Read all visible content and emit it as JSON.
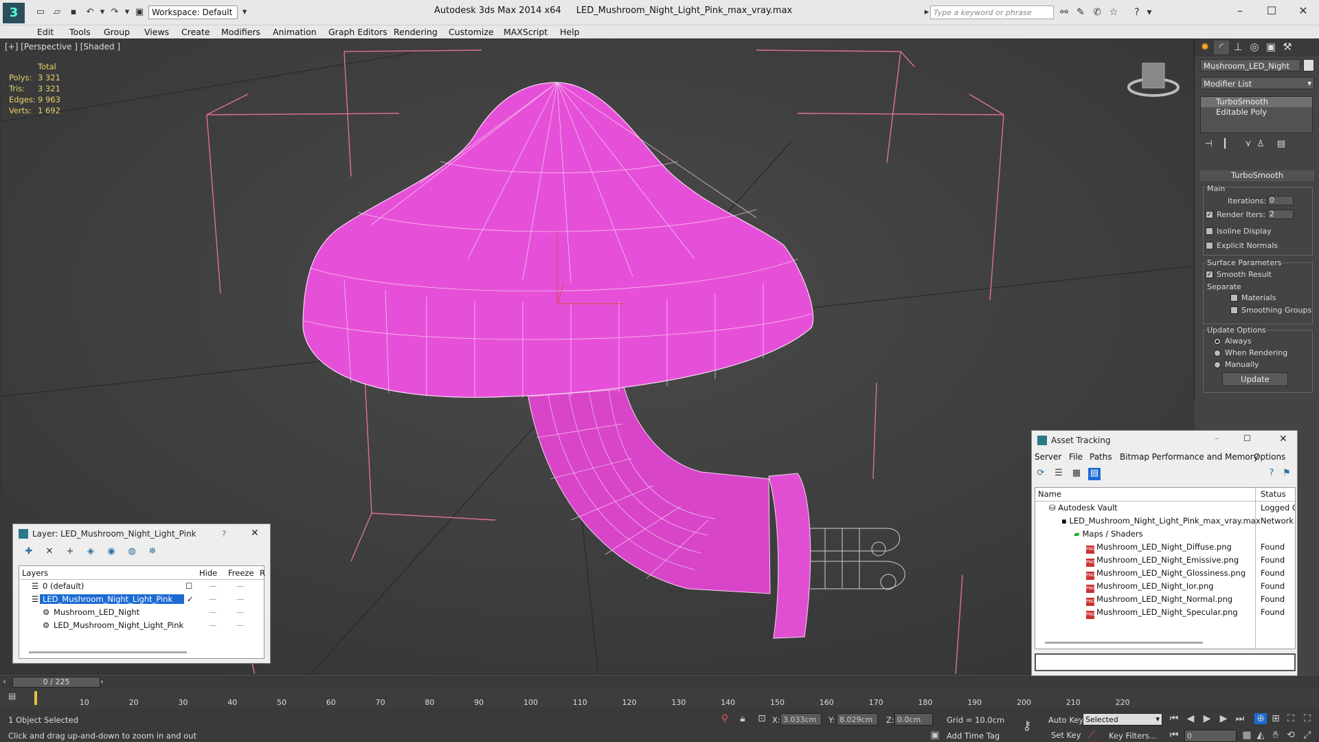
{
  "app": {
    "logo_text": "3",
    "workspace": "Workspace: Default",
    "title": "Autodesk 3ds Max  2014 x64",
    "filename": "LED_Mushroom_Night_Light_Pink_max_vray.max",
    "search_placeholder": "Type a keyword or phrase"
  },
  "menu": [
    "Edit",
    "Tools",
    "Group",
    "Views",
    "Create",
    "Modifiers",
    "Animation",
    "Graph Editors",
    "Rendering",
    "Customize",
    "MAXScript",
    "Help"
  ],
  "viewport": {
    "label": "[+] [Perspective ] [Shaded ]",
    "stats": {
      "header": "Total",
      "rows": [
        {
          "k": "Polys:",
          "v": "3 321"
        },
        {
          "k": "Tris:",
          "v": "3 321"
        },
        {
          "k": "Edges:",
          "v": "9 963"
        },
        {
          "k": "Verts:",
          "v": "1 692"
        }
      ]
    },
    "cap_color": "#e650d8",
    "stem_color": "#d845c9"
  },
  "command_panel": {
    "object_name": "Mushroom_LED_Night",
    "modifier_list": "Modifier List",
    "stack": [
      "TurboSmooth",
      "Editable Poly"
    ],
    "rollout": "TurboSmooth",
    "main_label": "Main",
    "iterations_label": "Iterations:",
    "iterations": "0",
    "render_iters_label": "Render Iters:",
    "render_iters": "2",
    "isoline": "Isoline Display",
    "explicit": "Explicit Normals",
    "surface_label": "Surface Parameters",
    "smooth_result": "Smooth Result",
    "separate": "Separate",
    "materials": "Materials",
    "smoothing_groups": "Smoothing Groups",
    "update_options": "Update Options",
    "always": "Always",
    "when_rendering": "When Rendering",
    "manually": "Manually",
    "update_btn": "Update"
  },
  "layer_window": {
    "title": "Layer: LED_Mushroom_Night_Light_Pink",
    "help": "?",
    "col_layers": "Layers",
    "col_hide": "Hide",
    "col_freeze": "Freeze",
    "col_r": "R",
    "rows": [
      {
        "name": "0 (default)"
      },
      {
        "name": "LED_Mushroom_Night_Light_Pink"
      },
      {
        "name": "Mushroom_LED_Night"
      },
      {
        "name": "LED_Mushroom_Night_Light_Pink"
      }
    ]
  },
  "asset_window": {
    "title": "Asset Tracking",
    "menu": [
      "Server",
      "File",
      "Paths",
      "Bitmap Performance and Memory",
      "Options"
    ],
    "col_name": "Name",
    "col_status": "Status",
    "rows": [
      {
        "name": "Autodesk Vault",
        "status": "Logged O"
      },
      {
        "name": "LED_Mushroom_Night_Light_Pink_max_vray.max",
        "status": "Network P"
      },
      {
        "name": "Maps / Shaders",
        "status": ""
      },
      {
        "name": "Mushroom_LED_Night_Diffuse.png",
        "status": "Found"
      },
      {
        "name": "Mushroom_LED_Night_Emissive.png",
        "status": "Found"
      },
      {
        "name": "Mushroom_LED_Night_Glossiness.png",
        "status": "Found"
      },
      {
        "name": "Mushroom_LED_Night_Ior.png",
        "status": "Found"
      },
      {
        "name": "Mushroom_LED_Night_Normal.png",
        "status": "Found"
      },
      {
        "name": "Mushroom_LED_Night_Specular.png",
        "status": "Found"
      }
    ]
  },
  "timeline": {
    "frame": "0 / 225",
    "ticks": [
      "10",
      "20",
      "30",
      "40",
      "50",
      "60",
      "70",
      "80",
      "90",
      "100",
      "110",
      "120",
      "130",
      "140",
      "150",
      "160",
      "170",
      "180",
      "190",
      "200",
      "210",
      "220"
    ]
  },
  "status": {
    "selected": "1 Object Selected",
    "hint": "Click and drag up-and-down to zoom in and out",
    "x_label": "X:",
    "x": "3.033cm",
    "y_label": "Y:",
    "y": "8.029cm",
    "z_label": "Z:",
    "z": "0.0cm",
    "grid": "Grid = 10.0cm",
    "autokey": "Auto Key",
    "setkey": "Set Key",
    "selected_dd": "Selected",
    "key_filters": "Key Filters...",
    "add_time_tag": "Add Time Tag",
    "frame_field": "0"
  }
}
